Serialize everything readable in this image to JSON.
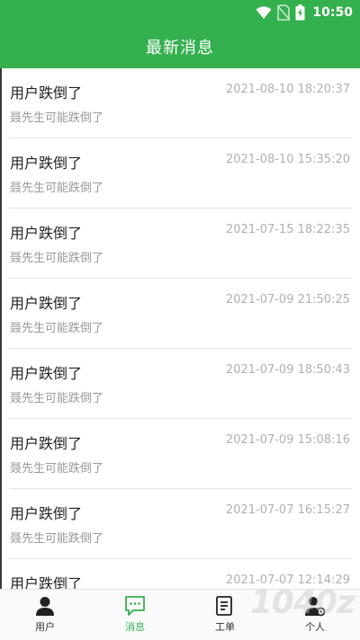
{
  "status_bar": {
    "time": "10:50",
    "icons": [
      "wifi-icon",
      "no-sim-icon",
      "battery-charging-icon"
    ]
  },
  "header": {
    "title": "最新消息"
  },
  "messages": [
    {
      "title": "用户跌倒了",
      "time": "2021-08-10 18:20:37",
      "body": "聂先生可能跌倒了"
    },
    {
      "title": "用户跌倒了",
      "time": "2021-08-10 15:35:20",
      "body": "聂先生可能跌倒了"
    },
    {
      "title": "用户跌倒了",
      "time": "2021-07-15 18:22:35",
      "body": "聂先生可能跌倒了"
    },
    {
      "title": "用户跌倒了",
      "time": "2021-07-09 21:50:25",
      "body": "聂先生可能跌倒了"
    },
    {
      "title": "用户跌倒了",
      "time": "2021-07-09 18:50:43",
      "body": "聂先生可能跌倒了"
    },
    {
      "title": "用户跌倒了",
      "time": "2021-07-09 15:08:16",
      "body": "聂先生可能跌倒了"
    },
    {
      "title": "用户跌倒了",
      "time": "2021-07-07 16:15:27",
      "body": "聂先生可能跌倒了"
    },
    {
      "title": "用户跌倒了",
      "time": "2021-07-07 12:14:29",
      "body": ""
    }
  ],
  "bottom_nav": [
    {
      "label": "用户",
      "icon": "user-icon",
      "active": false
    },
    {
      "label": "消息",
      "icon": "message-icon",
      "active": true
    },
    {
      "label": "工单",
      "icon": "work-order-icon",
      "active": false
    },
    {
      "label": "个人",
      "icon": "settings-person-icon",
      "active": false
    }
  ],
  "watermark": "1040z",
  "colors": {
    "brand": "#34b04e",
    "timestamp": "#b0b0b0",
    "body_text": "#9a9a9a"
  }
}
